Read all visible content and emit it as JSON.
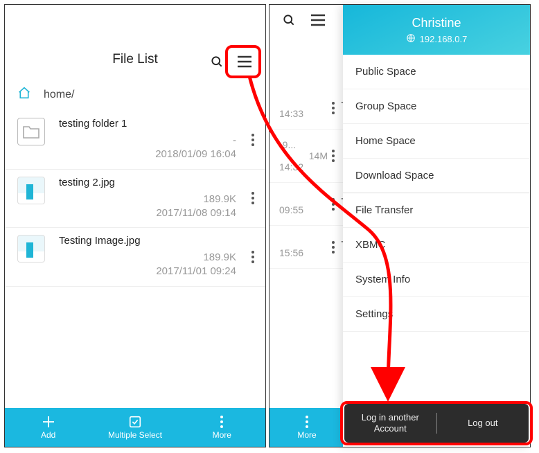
{
  "left": {
    "title": "File List",
    "breadcrumb": "home/",
    "files": [
      {
        "name": "testing folder 1",
        "size": "-",
        "date": "2018/01/09 16:04",
        "kind": "folder"
      },
      {
        "name": "testing 2.jpg",
        "size": "189.9K",
        "date": "2017/11/08 09:14",
        "kind": "image"
      },
      {
        "name": "Testing Image.jpg",
        "size": "189.9K",
        "date": "2017/11/01 09:24",
        "kind": "image"
      }
    ],
    "bottom": {
      "add": "Add",
      "multi": "Multiple Select",
      "more": "More"
    }
  },
  "right": {
    "peek_rows": [
      {
        "t": "- ",
        "s": "14:33"
      },
      {
        "t": "-9...",
        "s1": "14M",
        "s2": "14:32"
      },
      {
        "t": "- ",
        "s": "09:55"
      },
      {
        "t": "- ",
        "s": "15:56"
      }
    ],
    "bottom_more": "More",
    "drawer": {
      "name": "Christine",
      "ip": "192.168.0.7",
      "items_a": [
        "Public Space",
        "Group Space",
        "Home Space",
        "Download Space"
      ],
      "items_b": [
        "File Transfer",
        "XBMC",
        "System Info",
        "Settings"
      ],
      "login_another": "Log in another Account",
      "logout": "Log out"
    }
  }
}
